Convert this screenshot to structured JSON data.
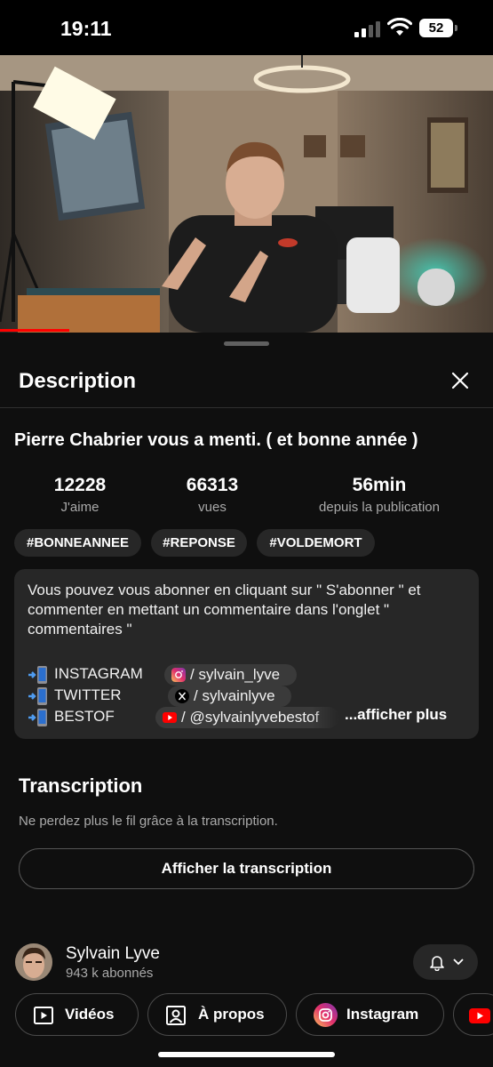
{
  "status_bar": {
    "time": "19:11",
    "battery": "52"
  },
  "video": {
    "progress_fraction": 0.14
  },
  "sheet": {
    "title": "Description"
  },
  "video_info": {
    "title": "Pierre Chabrier vous a menti. ( et bonne année )",
    "stats": [
      {
        "value": "12228",
        "label": "J'aime"
      },
      {
        "value": "66313",
        "label": "vues"
      },
      {
        "value": "56min",
        "label": "depuis la publication"
      }
    ],
    "hashtags": [
      "#BONNEANNEE",
      "#REPONSE",
      "#VOLDEMORT"
    ]
  },
  "description": {
    "text": "Vous pouvez vous abonner en cliquant sur \" S'abonner \" et commenter en mettant un commentaire dans l'onglet \" commentaires \"",
    "links": [
      {
        "name": "INSTAGRAM",
        "handle": "/ sylvain_lyve",
        "icon": "instagram-icon"
      },
      {
        "name": "TWITTER",
        "handle": "/ sylvainlyve",
        "icon": "x-icon"
      },
      {
        "name": "BESTOF",
        "handle": "/ @sylvainlyvebestof",
        "icon": "youtube-icon"
      }
    ],
    "more_label": "...afficher plus"
  },
  "transcription": {
    "title": "Transcription",
    "subtitle": "Ne perdez plus le fil grâce à la transcription.",
    "button_label": "Afficher la transcription"
  },
  "channel": {
    "name": "Sylvain Lyve",
    "subscribers": "943 k abonnés",
    "actions": [
      {
        "label": "Vidéos",
        "icon": "video-play-icon"
      },
      {
        "label": "À propos",
        "icon": "person-card-icon"
      },
      {
        "label": "Instagram",
        "icon": "instagram-icon"
      },
      {
        "label": "",
        "icon": "youtube-icon"
      }
    ]
  },
  "colors": {
    "accent": "#ff0000",
    "background": "#0f0f0f",
    "surface": "#272727"
  }
}
